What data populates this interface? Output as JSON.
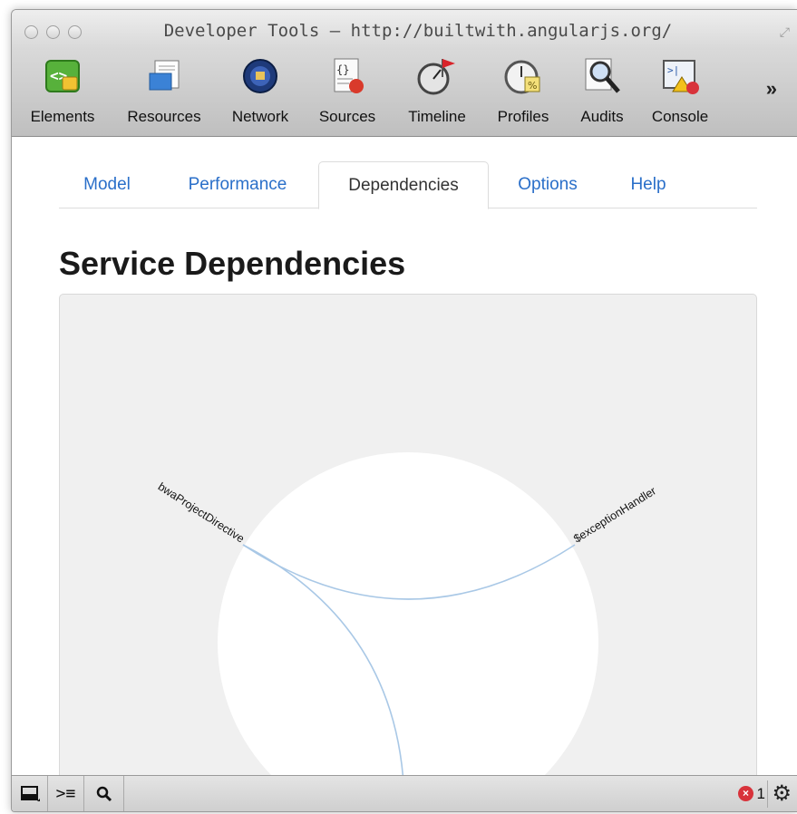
{
  "window": {
    "title": "Developer Tools – http://builtwith.angularjs.org/"
  },
  "toolbar": {
    "items": [
      {
        "label": "Elements",
        "icon": "elements-icon"
      },
      {
        "label": "Resources",
        "icon": "resources-icon"
      },
      {
        "label": "Network",
        "icon": "network-icon"
      },
      {
        "label": "Sources",
        "icon": "sources-icon"
      },
      {
        "label": "Timeline",
        "icon": "timeline-icon"
      },
      {
        "label": "Profiles",
        "icon": "profiles-icon"
      },
      {
        "label": "Audits",
        "icon": "audits-icon"
      },
      {
        "label": "Console",
        "icon": "console-icon"
      }
    ],
    "overflow": "»"
  },
  "tabs": [
    {
      "label": "Model"
    },
    {
      "label": "Performance"
    },
    {
      "label": "Dependencies",
      "active": true
    },
    {
      "label": "Options"
    },
    {
      "label": "Help"
    }
  ],
  "page": {
    "heading": "Service Dependencies"
  },
  "graph": {
    "nodes": [
      "bwaProjectDirective",
      "$exceptionHandler"
    ],
    "edges": [
      {
        "from": "bwaProjectDirective",
        "to": "$exceptionHandler"
      },
      {
        "from": "bwaProjectDirective",
        "to": "(offscreen)"
      }
    ],
    "link_color": "#a9c8e6"
  },
  "statusbar": {
    "error_count": "1",
    "error_color": "#d8333b"
  }
}
